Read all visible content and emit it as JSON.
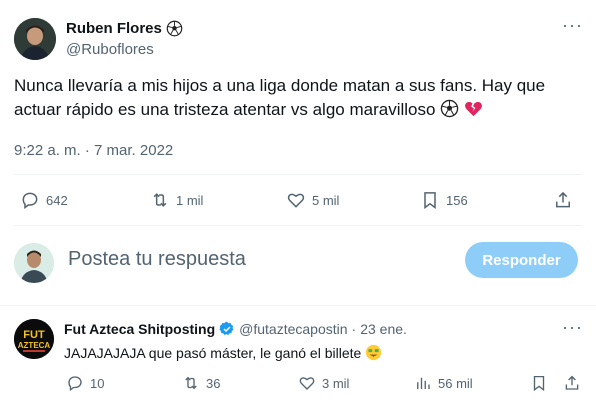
{
  "tweet": {
    "author_name": "Ruben Flores",
    "author_handle": "@Ruboflores",
    "text": "Nunca llevaría a mis hijos a una liga donde matan a sus fans. Hay que actuar rápido es una tristeza atentar vs algo maravilloso",
    "time": "9:22 a. m. · 7 mar. 2022",
    "replies": "642",
    "reposts": "1 mil",
    "likes": "5 mil",
    "bookmarks": "156"
  },
  "reply_box": {
    "placeholder": "Postea tu respuesta",
    "button_label": "Responder"
  },
  "reply_tweet": {
    "author_name": "Fut Azteca Shitposting",
    "author_handle": "@futaztecapostin",
    "separator": "·",
    "date": "23 ene.",
    "text": "JAJAJAJAJA que pasó máster, le ganó el billete",
    "avatar_text_top": "FUT",
    "avatar_text_bottom": "AZTECA",
    "replies": "10",
    "reposts": "36",
    "likes": "3 mil",
    "views": "56 mil"
  },
  "colors": {
    "primary_text": "#0f1419",
    "secondary_text": "#536471",
    "button_disabled": "#8ecdf8",
    "verified": "#1d9bf0",
    "heart_broken": "#e0245e"
  },
  "icons": [
    "soccer-ball-icon",
    "broken-heart-icon",
    "money-face-emoji-icon",
    "more-icon",
    "reply-icon",
    "repost-icon",
    "like-icon",
    "bookmark-icon",
    "share-icon",
    "views-icon",
    "verified-badge-icon"
  ]
}
